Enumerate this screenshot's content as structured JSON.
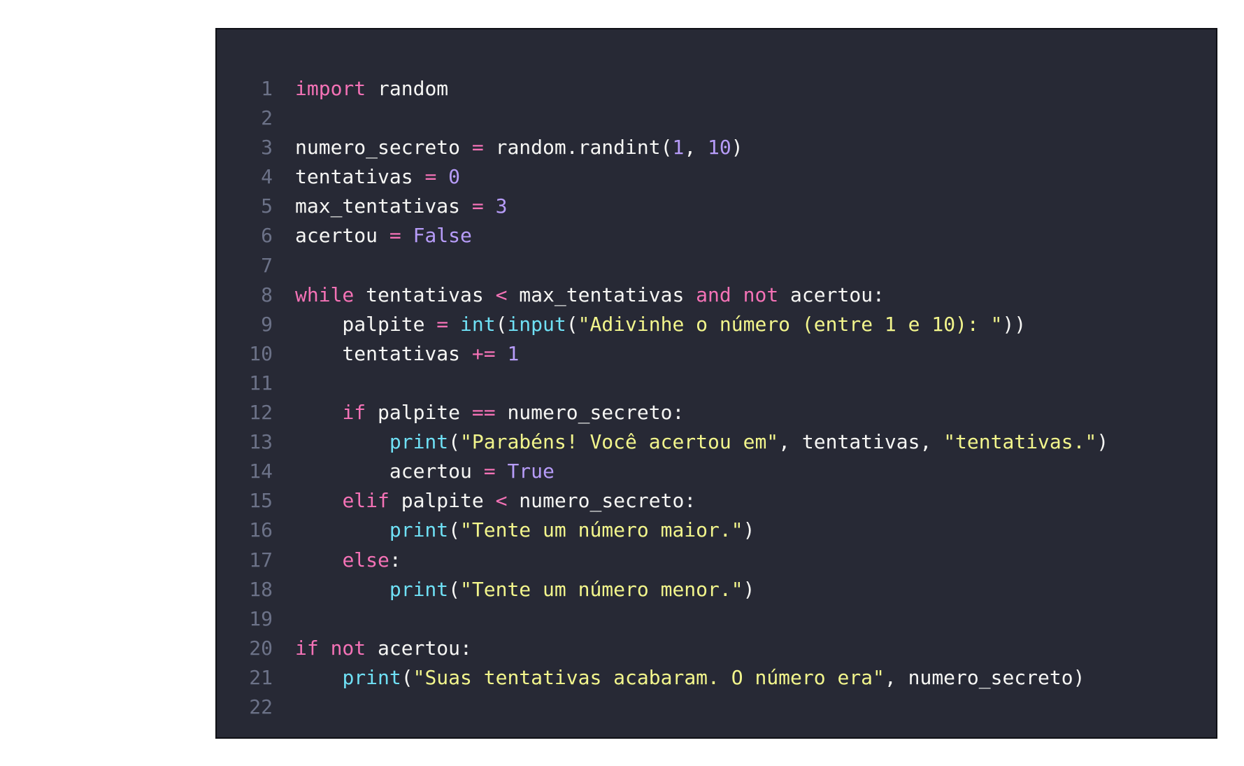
{
  "editor": {
    "language": "python",
    "background_color": "#272935",
    "token_colors": {
      "kw": "#f472b6",
      "op": "#f472b6",
      "num": "#b79cf9",
      "const": "#b79cf9",
      "fn": "#6fe0f5",
      "str": "#f2f58c",
      "pl": "#f6f6f4",
      "line_number": "#6c7288"
    },
    "lines": [
      {
        "n": "1",
        "tokens": [
          [
            "kw",
            "import"
          ],
          [
            "pl",
            " random"
          ]
        ]
      },
      {
        "n": "2",
        "tokens": []
      },
      {
        "n": "3",
        "tokens": [
          [
            "pl",
            "numero_secreto "
          ],
          [
            "op",
            "="
          ],
          [
            "pl",
            " random.randint("
          ],
          [
            "num",
            "1"
          ],
          [
            "pl",
            ", "
          ],
          [
            "num",
            "10"
          ],
          [
            "pl",
            ")"
          ]
        ]
      },
      {
        "n": "4",
        "tokens": [
          [
            "pl",
            "tentativas "
          ],
          [
            "op",
            "="
          ],
          [
            "pl",
            " "
          ],
          [
            "num",
            "0"
          ]
        ]
      },
      {
        "n": "5",
        "tokens": [
          [
            "pl",
            "max_tentativas "
          ],
          [
            "op",
            "="
          ],
          [
            "pl",
            " "
          ],
          [
            "num",
            "3"
          ]
        ]
      },
      {
        "n": "6",
        "tokens": [
          [
            "pl",
            "acertou "
          ],
          [
            "op",
            "="
          ],
          [
            "pl",
            " "
          ],
          [
            "const",
            "False"
          ]
        ]
      },
      {
        "n": "7",
        "tokens": []
      },
      {
        "n": "8",
        "tokens": [
          [
            "kw",
            "while"
          ],
          [
            "pl",
            " tentativas "
          ],
          [
            "op",
            "<"
          ],
          [
            "pl",
            " max_tentativas "
          ],
          [
            "kw",
            "and"
          ],
          [
            "pl",
            " "
          ],
          [
            "kw",
            "not"
          ],
          [
            "pl",
            " acertou:"
          ]
        ]
      },
      {
        "n": "9",
        "tokens": [
          [
            "pl",
            "    palpite "
          ],
          [
            "op",
            "="
          ],
          [
            "pl",
            " "
          ],
          [
            "fn",
            "int"
          ],
          [
            "pl",
            "("
          ],
          [
            "fn",
            "input"
          ],
          [
            "pl",
            "("
          ],
          [
            "str",
            "\"Adivinhe o número (entre 1 e 10): \""
          ],
          [
            "pl",
            "))"
          ]
        ]
      },
      {
        "n": "10",
        "tokens": [
          [
            "pl",
            "    tentativas "
          ],
          [
            "op",
            "+="
          ],
          [
            "pl",
            " "
          ],
          [
            "num",
            "1"
          ]
        ]
      },
      {
        "n": "11",
        "tokens": []
      },
      {
        "n": "12",
        "tokens": [
          [
            "pl",
            "    "
          ],
          [
            "kw",
            "if"
          ],
          [
            "pl",
            " palpite "
          ],
          [
            "op",
            "=="
          ],
          [
            "pl",
            " numero_secreto:"
          ]
        ]
      },
      {
        "n": "13",
        "tokens": [
          [
            "pl",
            "        "
          ],
          [
            "fn",
            "print"
          ],
          [
            "pl",
            "("
          ],
          [
            "str",
            "\"Parabéns! Você acertou em\""
          ],
          [
            "pl",
            ", tentativas, "
          ],
          [
            "str",
            "\"tentativas.\""
          ],
          [
            "pl",
            ")"
          ]
        ]
      },
      {
        "n": "14",
        "tokens": [
          [
            "pl",
            "        acertou "
          ],
          [
            "op",
            "="
          ],
          [
            "pl",
            " "
          ],
          [
            "const",
            "True"
          ]
        ]
      },
      {
        "n": "15",
        "tokens": [
          [
            "pl",
            "    "
          ],
          [
            "kw",
            "elif"
          ],
          [
            "pl",
            " palpite "
          ],
          [
            "op",
            "<"
          ],
          [
            "pl",
            " numero_secreto:"
          ]
        ]
      },
      {
        "n": "16",
        "tokens": [
          [
            "pl",
            "        "
          ],
          [
            "fn",
            "print"
          ],
          [
            "pl",
            "("
          ],
          [
            "str",
            "\"Tente um número maior.\""
          ],
          [
            "pl",
            ")"
          ]
        ]
      },
      {
        "n": "17",
        "tokens": [
          [
            "pl",
            "    "
          ],
          [
            "kw",
            "else"
          ],
          [
            "pl",
            ":"
          ]
        ]
      },
      {
        "n": "18",
        "tokens": [
          [
            "pl",
            "        "
          ],
          [
            "fn",
            "print"
          ],
          [
            "pl",
            "("
          ],
          [
            "str",
            "\"Tente um número menor.\""
          ],
          [
            "pl",
            ")"
          ]
        ]
      },
      {
        "n": "19",
        "tokens": []
      },
      {
        "n": "20",
        "tokens": [
          [
            "kw",
            "if"
          ],
          [
            "pl",
            " "
          ],
          [
            "kw",
            "not"
          ],
          [
            "pl",
            " acertou:"
          ]
        ]
      },
      {
        "n": "21",
        "tokens": [
          [
            "pl",
            "    "
          ],
          [
            "fn",
            "print"
          ],
          [
            "pl",
            "("
          ],
          [
            "str",
            "\"Suas tentativas acabaram. O número era\""
          ],
          [
            "pl",
            ", numero_secreto)"
          ]
        ]
      },
      {
        "n": "22",
        "tokens": []
      }
    ]
  }
}
